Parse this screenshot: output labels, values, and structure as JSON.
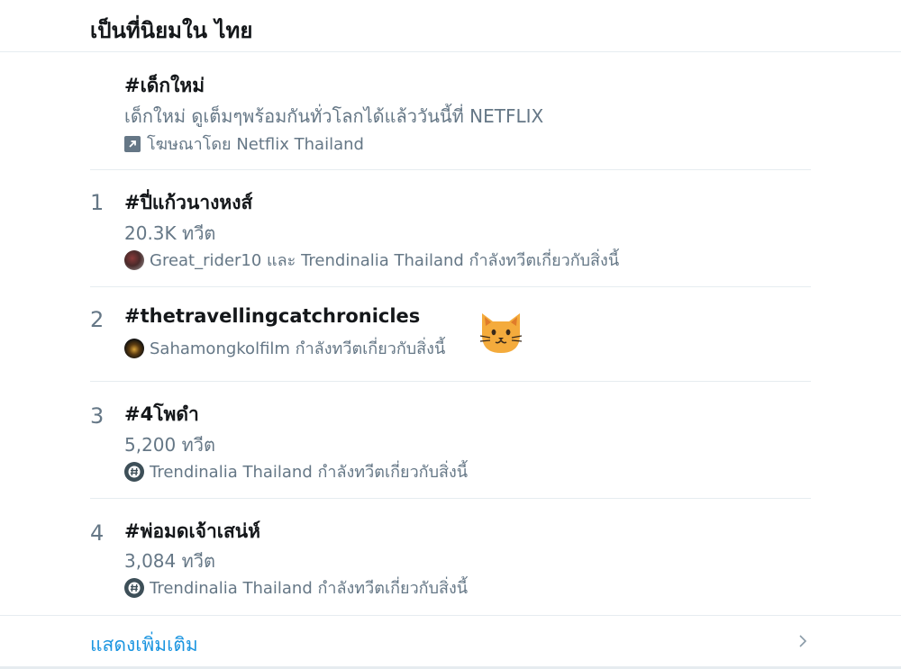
{
  "header": {
    "title": "เป็นที่นิยมใน ไทย"
  },
  "promoted": {
    "hashtag": "#เด็กใหม่",
    "description": "เด็กใหม่ ดูเต็มๆพร้อมกันทั่วโลกได้แล้ววันนี้ที่ NETFLIX",
    "promoted_by": "โฆษณาโดย Netflix Thailand"
  },
  "trends": [
    {
      "rank": "1",
      "hashtag": "#ปี่แก้วนางหงส์",
      "tweet_count": "20.3K ทวีต",
      "context": "Great_rider10 และ Trendinalia Thailand กำลังทวีตเกี่ยวกับสิ่งนี้"
    },
    {
      "rank": "2",
      "hashtag": "#thetravellingcatchronicles",
      "context": "Sahamongkolfilm กำลังทวีตเกี่ยวกับสิ่งนี้"
    },
    {
      "rank": "3",
      "hashtag": "#4โพดำ",
      "tweet_count": "5,200 ทวีต",
      "context": "Trendinalia Thailand กำลังทวีตเกี่ยวกับสิ่งนี้"
    },
    {
      "rank": "4",
      "hashtag": "#พ่อมดเจ้าเสน่ห์",
      "tweet_count": "3,084 ทวีต",
      "context": "Trendinalia Thailand กำลังทวีตเกี่ยวกับสิ่งนี้"
    }
  ],
  "footer": {
    "show_more": "แสดงเพิ่มเติม"
  },
  "colors": {
    "accent": "#1b95e0",
    "secondary_text": "#657786",
    "divider": "#e6ecf0",
    "cat_emoji": "#f4ab3c"
  },
  "icons": [
    "promoted-arrow-icon",
    "cat-emoji-icon",
    "chevron-right-icon",
    "trendinalia-hash-icon"
  ]
}
